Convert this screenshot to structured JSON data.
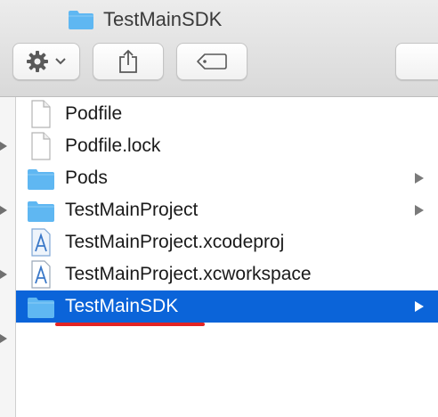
{
  "window": {
    "title": "TestMainSDK"
  },
  "toolbar": {
    "action_icon": "gear-icon",
    "share_icon": "share-icon",
    "tags_icon": "tag-icon"
  },
  "files": [
    {
      "name": "Podfile",
      "icon": "document-icon",
      "has_children": false,
      "selected": false
    },
    {
      "name": "Podfile.lock",
      "icon": "document-icon",
      "has_children": false,
      "selected": false
    },
    {
      "name": "Pods",
      "icon": "folder-icon",
      "has_children": true,
      "selected": false
    },
    {
      "name": "TestMainProject",
      "icon": "folder-icon",
      "has_children": true,
      "selected": false
    },
    {
      "name": "TestMainProject.xcodeproj",
      "icon": "xcodeproj-icon",
      "has_children": false,
      "selected": false
    },
    {
      "name": "TestMainProject.xcworkspace",
      "icon": "xcworkspace-icon",
      "has_children": false,
      "selected": false
    },
    {
      "name": "TestMainSDK",
      "icon": "folder-icon",
      "has_children": true,
      "selected": true
    }
  ],
  "colors": {
    "selection": "#0b64d9",
    "folder": "#5fb7f2",
    "annotation_underline": "#e32424"
  }
}
